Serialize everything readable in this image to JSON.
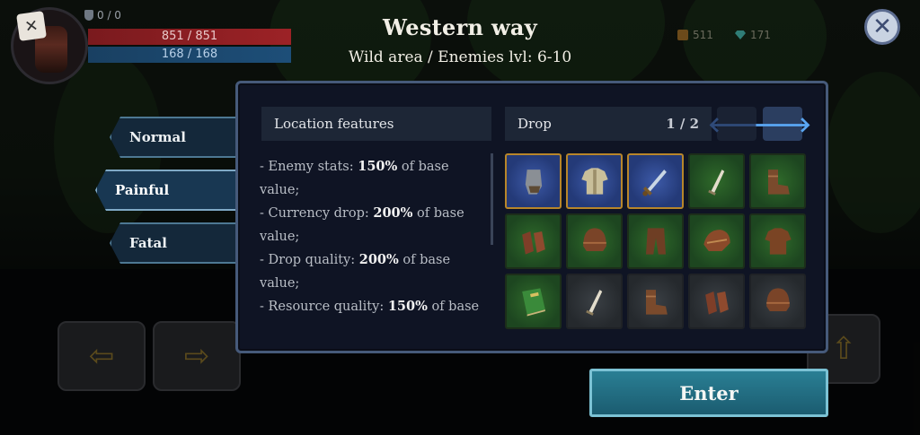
{
  "hud": {
    "shield_count": "0 / 0",
    "hp": "851 / 851",
    "mp": "168 / 168",
    "gold": "511",
    "gems": "171"
  },
  "location": {
    "title": "Western way",
    "subtitle": "Wild area / Enemies lvl: 6-10"
  },
  "difficulty_tabs": [
    {
      "label": "Normal",
      "selected": false
    },
    {
      "label": "Painful",
      "selected": true
    },
    {
      "label": "Fatal",
      "selected": false
    }
  ],
  "features": {
    "header": "Location features",
    "lines": [
      {
        "prefix": "- Enemy stats: ",
        "value": "150%",
        "suffix": " of base value;"
      },
      {
        "prefix": "- Currency drop: ",
        "value": "200%",
        "suffix": " of base value;"
      },
      {
        "prefix": "- Drop quality: ",
        "value": "200%",
        "suffix": " of base value;"
      },
      {
        "prefix": "- Resource quality: ",
        "value": "150%",
        "suffix": " of base"
      }
    ]
  },
  "drop": {
    "header": "Drop",
    "page": "1 / 2",
    "items": [
      {
        "icon": "gauntlet-icon",
        "rarity": "gold"
      },
      {
        "icon": "tunic-icon",
        "rarity": "gold"
      },
      {
        "icon": "sword-icon",
        "rarity": "gold"
      },
      {
        "icon": "dagger-icon",
        "rarity": "green"
      },
      {
        "icon": "boots-icon",
        "rarity": "green"
      },
      {
        "icon": "gloves-icon",
        "rarity": "green"
      },
      {
        "icon": "helmet-icon",
        "rarity": "green"
      },
      {
        "icon": "pants-icon",
        "rarity": "green"
      },
      {
        "icon": "shoulder-icon",
        "rarity": "green"
      },
      {
        "icon": "shirt-icon",
        "rarity": "green"
      },
      {
        "icon": "book-icon",
        "rarity": "green"
      },
      {
        "icon": "dagger-icon",
        "rarity": "gray"
      },
      {
        "icon": "boots-icon",
        "rarity": "gray"
      },
      {
        "icon": "gloves-icon",
        "rarity": "gray"
      },
      {
        "icon": "helmet-icon",
        "rarity": "gray"
      }
    ]
  },
  "enter_label": "Enter",
  "colors": {
    "panel_border": "#465a7a",
    "selected_tab": "#183752",
    "enter_button": "#1f6d82",
    "next_arrow": "#5aa6f2",
    "epic_border": "#b8862a"
  }
}
